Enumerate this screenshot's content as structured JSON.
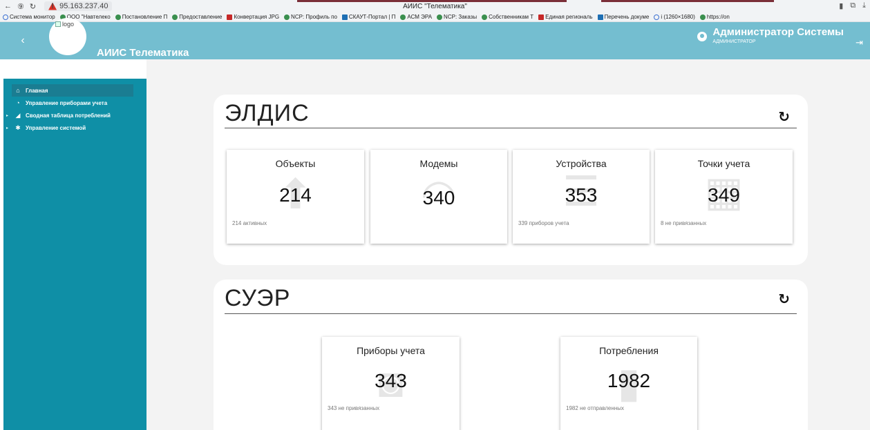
{
  "browser": {
    "url": "95.163.237.40",
    "window_title": "АИИС \"Телематика\""
  },
  "bookmarks": [
    {
      "label": "Система монитор",
      "icon": "ring"
    },
    {
      "label": "ООО \"Навтелеко",
      "icon": "green"
    },
    {
      "label": "Постановление П",
      "icon": "green"
    },
    {
      "label": "Предоставление",
      "icon": "green"
    },
    {
      "label": "Конвертация JPG",
      "icon": "red"
    },
    {
      "label": "NCP: Профиль по",
      "icon": "green"
    },
    {
      "label": "СКАУТ-Портал | П",
      "icon": "blue"
    },
    {
      "label": "АСМ ЭРА",
      "icon": "green"
    },
    {
      "label": "NCP: Заказы",
      "icon": "green"
    },
    {
      "label": "Собственникам Т",
      "icon": "green"
    },
    {
      "label": "Единая региональ",
      "icon": "red"
    },
    {
      "label": "Перечень докуме",
      "icon": "blue"
    },
    {
      "label": "i (1260×1680)",
      "icon": "ring"
    },
    {
      "label": "https://on",
      "icon": "green"
    }
  ],
  "header": {
    "logo_alt": "logo",
    "title": "АИИС Телематика",
    "user_name": "Администратор Системы",
    "user_role": "АДМИНИСТРАТОР"
  },
  "sidebar": {
    "items": [
      {
        "label": "Главная",
        "icon": "home-icon"
      },
      {
        "label": "Управление приборами учета",
        "icon": "gauge-icon"
      },
      {
        "label": "Сводная таблица потреблений",
        "icon": "signal-icon"
      },
      {
        "label": "Управление системой",
        "icon": "gear-icon"
      }
    ]
  },
  "eldis": {
    "title": "ЭЛДИС",
    "cards": [
      {
        "label": "Объекты",
        "value": "214",
        "sub": "214 активных"
      },
      {
        "label": "Модемы",
        "value": "340",
        "sub": ""
      },
      {
        "label": "Устройства",
        "value": "353",
        "sub": "339 приборов учета"
      },
      {
        "label": "Точки учета",
        "value": "349",
        "sub": "8 не привязанных"
      }
    ]
  },
  "suer": {
    "title": "СУЭР",
    "cards": [
      {
        "label": "Приборы учета",
        "value": "343",
        "sub": "343 не привязанных"
      },
      {
        "label": "Потребления",
        "value": "1982",
        "sub": "1982 не отправленных"
      }
    ]
  }
}
